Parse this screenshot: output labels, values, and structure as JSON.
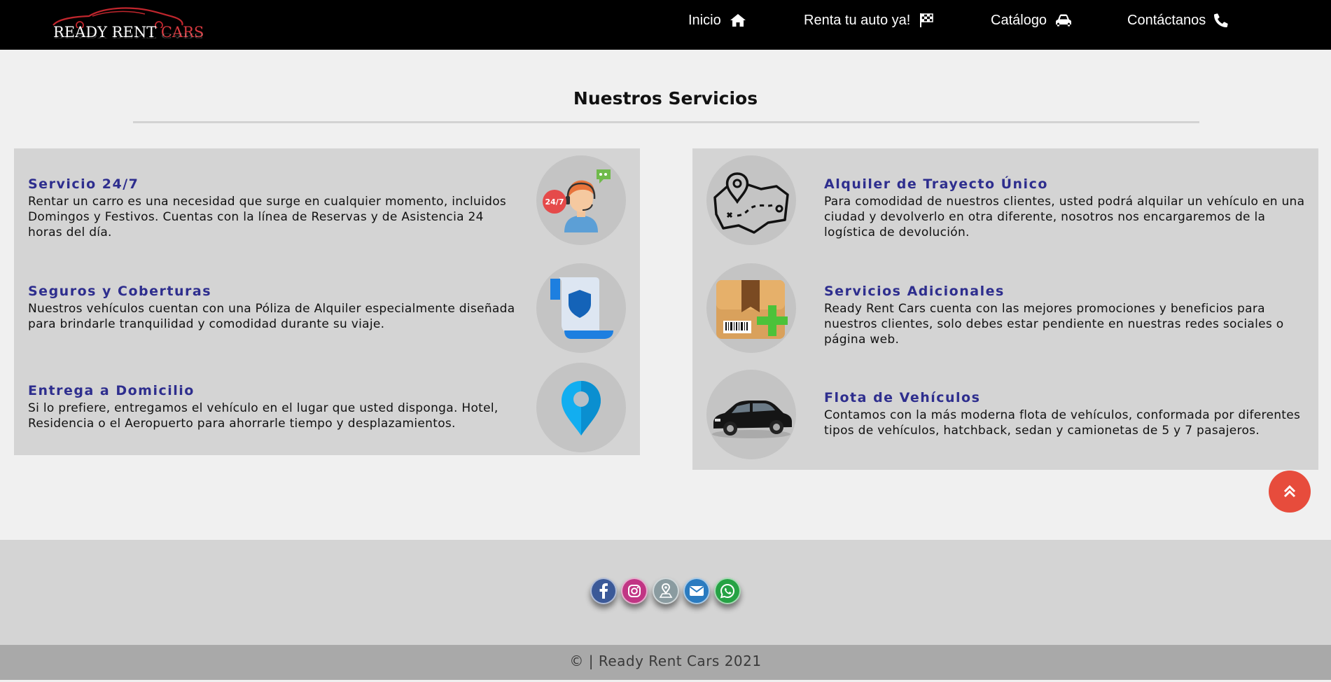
{
  "brand": {
    "logo_main": "READY RENT ",
    "logo_accent": "CARS"
  },
  "nav": {
    "items": [
      {
        "label": "Inicio",
        "icon": "home-icon"
      },
      {
        "label": "Renta tu auto ya!",
        "icon": "flag-checkered-icon"
      },
      {
        "label": "Catálogo",
        "icon": "car-icon"
      },
      {
        "label": "Contáctanos",
        "icon": "phone-icon"
      }
    ]
  },
  "section": {
    "title": "Nuestros Servicios"
  },
  "services_left": [
    {
      "title": "Servicio 24/7",
      "desc": "Rentar un carro es una necesidad que surge en cualquier momento, incluidos Domingos y Festivos. Cuentas con la línea de Reservas y de Asistencia 24 horas del día.",
      "icon": "support-agent-icon",
      "badge": "24/7"
    },
    {
      "title": "Seguros y Coberturas",
      "desc": "Nuestros vehículos cuentan con una Póliza de Alquiler especialmente diseñada para brindarle tranquilidad y comodidad durante su viaje.",
      "icon": "insurance-shield-icon"
    },
    {
      "title": "Entrega a Domicilio",
      "desc": "Si lo prefiere, entregamos el vehículo en el lugar que usted disponga. Hotel, Residencia o el Aeropuerto para ahorrarle tiempo y desplazamientos.",
      "icon": "location-pin-icon"
    }
  ],
  "services_right": [
    {
      "title": "Alquiler de Trayecto Único",
      "desc": "Para comodidad de nuestros clientes, usted podrá alquilar un vehículo en una ciudad y devolverlo en otra diferente, nosotros nos encargaremos de la logística de devolución.",
      "icon": "route-map-icon"
    },
    {
      "title": "Servicios Adicionales",
      "desc": "Ready Rent Cars cuenta con las mejores promociones y beneficios para nuestros clientes, solo debes estar pendiente en nuestras redes sociales o página web.",
      "icon": "package-add-icon"
    },
    {
      "title": "Flota de Vehículos",
      "desc": "Contamos con la más moderna flota de vehículos, conformada por diferentes tipos de vehículos, hatchback, sedan y camionetas de 5 y 7 pasajeros.",
      "icon": "sedan-car-icon"
    }
  ],
  "social": [
    {
      "name": "facebook-icon",
      "color": "#3b5998"
    },
    {
      "name": "instagram-icon",
      "color": "#c13584"
    },
    {
      "name": "map-location-icon",
      "color": "#8a9ba0"
    },
    {
      "name": "email-icon",
      "color": "#2a7bc0"
    },
    {
      "name": "whatsapp-icon",
      "color": "#25a244"
    }
  ],
  "footer": {
    "copyright": "© | Ready Rent Cars 2021"
  },
  "colors": {
    "navbar": "#000000",
    "service_title": "#2e2e8e",
    "panel": "#d4d4d4",
    "back_to_top": "#e74c3c"
  }
}
